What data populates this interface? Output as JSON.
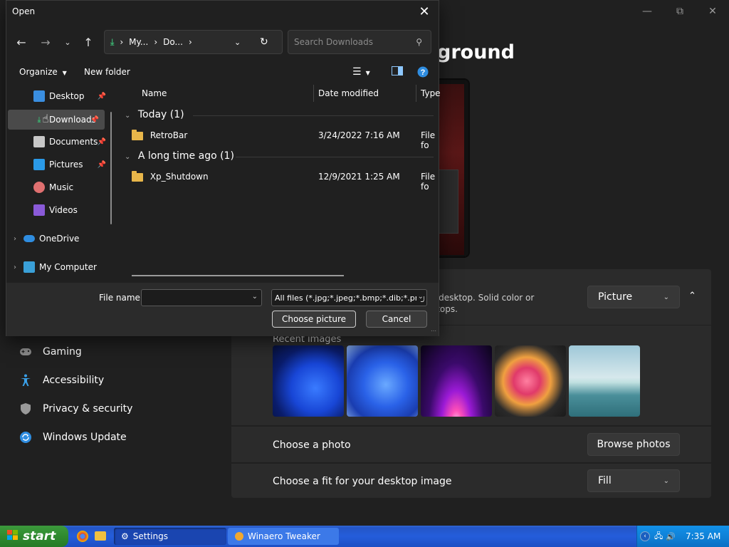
{
  "settings": {
    "heading": "ground",
    "nav": [
      {
        "label": "Gaming",
        "icon": "gamepad-icon"
      },
      {
        "label": "Accessibility",
        "icon": "accessibility-icon"
      },
      {
        "label": "Privacy & security",
        "icon": "shield-icon"
      },
      {
        "label": "Windows Update",
        "icon": "update-icon"
      }
    ],
    "background_desc_line1": "nt desktop. Solid color or",
    "background_desc_line2": "sktops.",
    "background_type": "Picture",
    "recent_images_label": "Recent images",
    "choose_photo_label": "Choose a photo",
    "browse_photos": "Browse photos",
    "choose_fit_label": "Choose a fit for your desktop image",
    "fit_value": "Fill"
  },
  "dialog": {
    "title": "Open",
    "breadcrumb": [
      "My...",
      "Do..."
    ],
    "search_placeholder": "Search Downloads",
    "organize": "Organize",
    "new_folder": "New folder",
    "sidebar": [
      {
        "label": "Desktop",
        "pinned": true
      },
      {
        "label": "Downloads",
        "pinned": true
      },
      {
        "label": "Documents",
        "pinned": true
      },
      {
        "label": "Pictures",
        "pinned": true
      },
      {
        "label": "Music",
        "pinned": false
      },
      {
        "label": "Videos",
        "pinned": false
      },
      {
        "label": "OneDrive",
        "pinned": false
      },
      {
        "label": "My Computer",
        "pinned": false
      }
    ],
    "columns": {
      "name": "Name",
      "date": "Date modified",
      "type": "Type"
    },
    "groups": [
      {
        "label": "Today (1)",
        "files": [
          {
            "name": "RetroBar",
            "date": "3/24/2022 7:16 AM",
            "type": "File fo"
          }
        ]
      },
      {
        "label": "A long time ago (1)",
        "files": [
          {
            "name": "Xp_Shutdown",
            "date": "12/9/2021 1:25 AM",
            "type": "File fo"
          }
        ]
      }
    ],
    "file_name_label": "File name:",
    "file_name_value": "",
    "file_type": "All files (*.jpg;*.jpeg;*.bmp;*.dib;*.png",
    "choose_button": "Choose picture",
    "cancel_button": "Cancel"
  },
  "taskbar": {
    "start": "start",
    "tasks": [
      "Settings",
      "Winaero Tweaker"
    ],
    "time": "7:35 AM"
  }
}
